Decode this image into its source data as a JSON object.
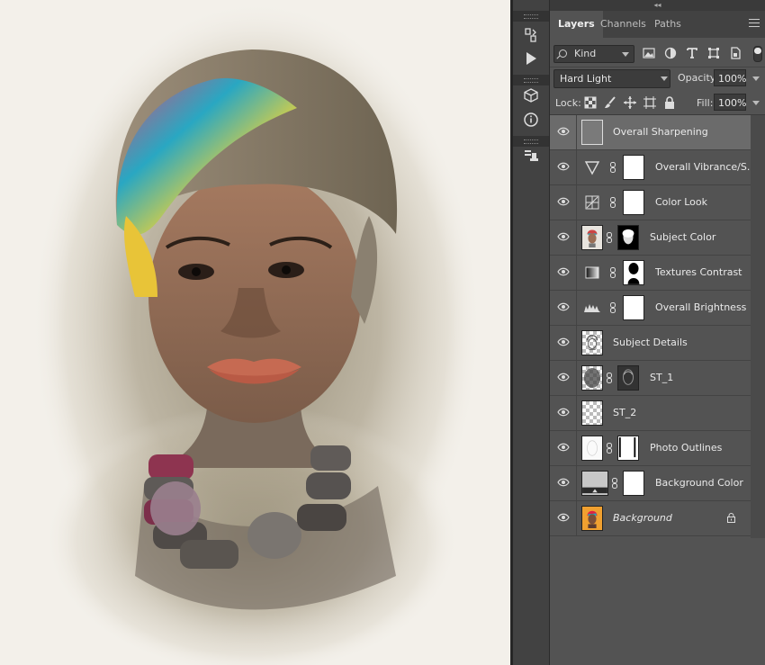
{
  "panel": {
    "collapse_glyph": "◂◂",
    "tabs": [
      "Layers",
      "Channels",
      "Paths"
    ],
    "active_tab": "Layers",
    "menu_icon": "panel-menu-icon",
    "filter": {
      "kind_label": "Kind",
      "filter_icons": [
        "image-filter-icon",
        "adjustment-filter-icon",
        "type-filter-icon",
        "shape-filter-icon",
        "smart-object-filter-icon"
      ]
    },
    "blend_mode": "Hard Light",
    "opacity_label": "Opacity:",
    "opacity_value": "100%",
    "lock_label": "Lock:",
    "lock_icons": [
      "lock-transparent-icon",
      "lock-paint-icon",
      "lock-position-icon",
      "lock-artboard-icon",
      "lock-all-icon"
    ],
    "fill_label": "Fill:",
    "fill_value": "100%"
  },
  "toolstrip_icons": [
    "history-icon",
    "play-actions-icon",
    "3d-icon",
    "info-icon",
    "clone-source-icon"
  ],
  "layers": [
    {
      "name": "Overall Sharpening",
      "selected": true,
      "thumb": "gray",
      "mask": false
    },
    {
      "name": "Overall Vibrance/S...",
      "thumb": "vibrance",
      "mask": "white"
    },
    {
      "name": "Color Look",
      "thumb": "colorlookup",
      "mask": "white"
    },
    {
      "name": "Subject Color",
      "thumb": "portrait",
      "mask": "subject-mask"
    },
    {
      "name": "Textures Contrast",
      "thumb": "gradient",
      "mask": "silhouette"
    },
    {
      "name": "Overall Brightness",
      "thumb": "levels",
      "mask": "white"
    },
    {
      "name": "Subject Details",
      "thumb": "sketch",
      "mask": false
    },
    {
      "name": "ST_1",
      "thumb": "texture",
      "mask": "sketch-mask"
    },
    {
      "name": "ST_2",
      "thumb": "transparent",
      "mask": false
    },
    {
      "name": "Photo Outlines",
      "thumb": "outline",
      "mask": "outline-mask"
    },
    {
      "name": "Background Color",
      "thumb": "solid-gray",
      "mask": "white"
    },
    {
      "name": "Background",
      "thumb": "portrait-color",
      "mask": false,
      "italic": true,
      "locked": true
    }
  ]
}
